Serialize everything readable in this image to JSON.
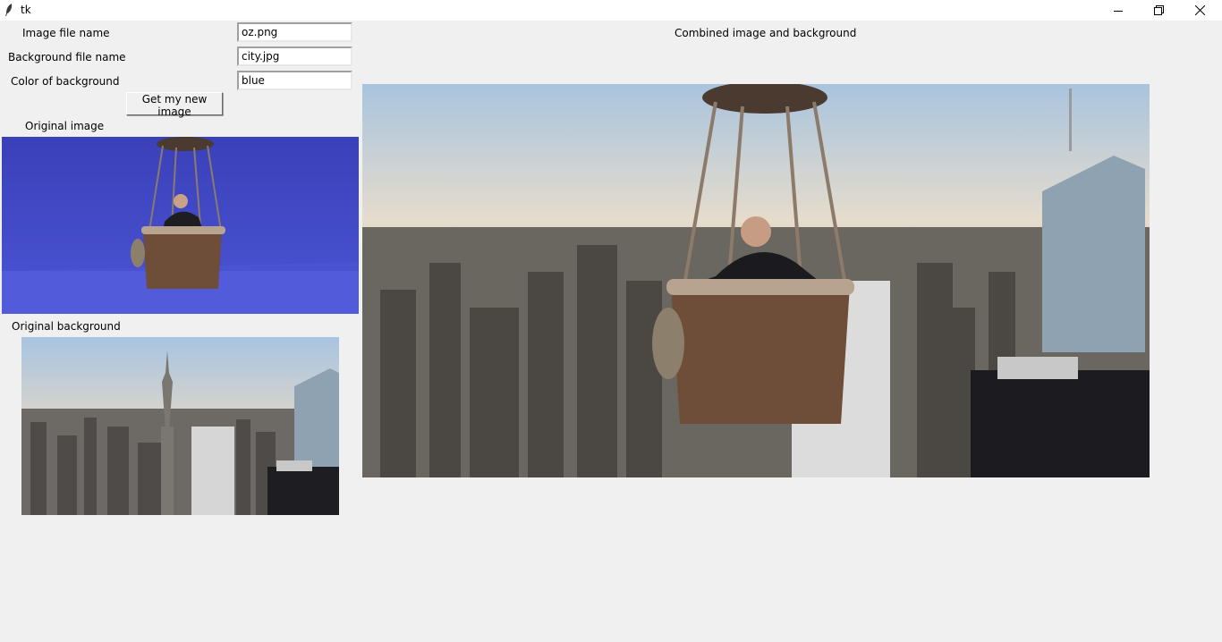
{
  "window": {
    "title": "tk",
    "controls": [
      "minimize-icon",
      "maximize-icon",
      "close-icon"
    ]
  },
  "form": {
    "image_file_label": "Image file name",
    "image_file_value": "oz.png",
    "background_file_label": "Background file name",
    "background_file_value": "city.jpg",
    "color_label": "Color of background",
    "color_value": "blue",
    "submit_label": "Get my new image"
  },
  "panels": {
    "original_image_label": "Original image",
    "original_background_label": "Original background",
    "combined_label": "Combined image and background"
  },
  "colors": {
    "window_bg": "#f0f0f0",
    "chroma_blue": "#3f48c8",
    "sky": "#cfd8e0",
    "city": "#5a5550",
    "basket": "#6b4a33"
  }
}
